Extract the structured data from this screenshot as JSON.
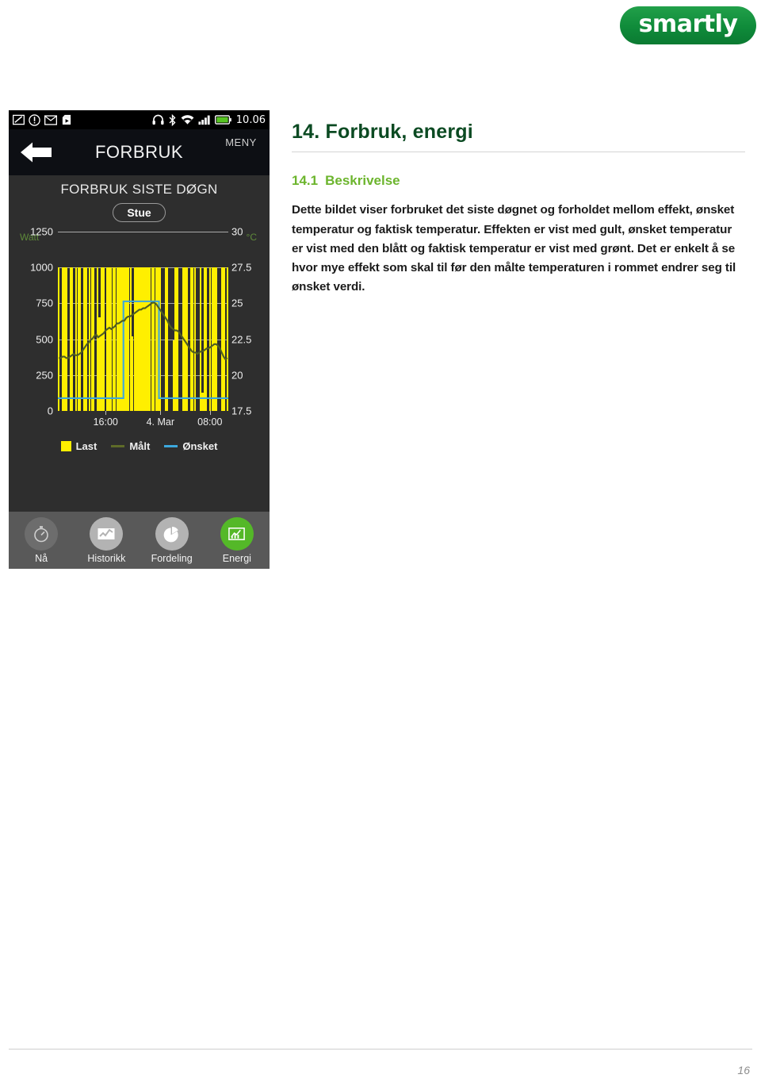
{
  "brand": {
    "name": "smartly",
    "color": "#0f8b3a"
  },
  "document": {
    "heading": "14. Forbruk, energi",
    "subheading_number": "14.1",
    "subheading_title": "Beskrivelse",
    "body": "Dette bildet viser forbruket det siste døgnet og forholdet mellom effekt, ønsket temperatur og faktisk temperatur. Effekten er vist med gult, ønsket temperatur er vist med den blått og faktisk temperatur er vist med grønt. Det er enkelt å se hvor mye effekt som skal til før den målte temperaturen i rommet endrer seg til ønsket verdi.",
    "page_number": "16"
  },
  "phone": {
    "statusbar": {
      "time": "10.06",
      "left_icons": [
        "note-icon",
        "warning-circle-icon",
        "mail-icon",
        "media-play-icon"
      ],
      "right_icons": [
        "headphones-icon",
        "bluetooth-icon",
        "wifi-icon",
        "signal-bars-icon",
        "battery-icon"
      ]
    },
    "titlebar": {
      "back_label": "back-arrow-icon",
      "title": "FORBRUK",
      "menu_label": "MENY"
    },
    "section_title": "FORBRUK SISTE DØGN",
    "room_selector": "Stue",
    "legend": [
      {
        "label": "Last",
        "color": "#ffef00",
        "kind": "box"
      },
      {
        "label": "Målt",
        "color": "#5e6b28",
        "kind": "line"
      },
      {
        "label": "Ønsket",
        "color": "#3ca8dd",
        "kind": "line"
      }
    ],
    "bottom_nav": [
      {
        "label": "Nå",
        "icon": "stopwatch-icon",
        "active": false
      },
      {
        "label": "Historikk",
        "icon": "line-chart-icon",
        "active": false
      },
      {
        "label": "Fordeling",
        "icon": "pie-chart-icon",
        "active": false
      },
      {
        "label": "Energi",
        "icon": "energy-chart-icon",
        "active": true
      }
    ]
  },
  "chart_data": {
    "type": "bar",
    "title": "FORBRUK SISTE DØGN",
    "xlabel": "",
    "ylabel": "Watt",
    "y2label": "°C",
    "ylim": [
      0,
      1250
    ],
    "y2lim": [
      17.5,
      30
    ],
    "yticks": [
      0,
      250,
      500,
      750,
      1000,
      1250
    ],
    "y2ticks": [
      17.5,
      20,
      22.5,
      25,
      27.5,
      30
    ],
    "xticks": [
      "16:00",
      "4. Mar",
      "08:00"
    ],
    "xtick_positions": [
      0.27,
      0.58,
      0.86
    ],
    "grid": true,
    "legend_position": "bottom",
    "series": [
      {
        "name": "Last",
        "type": "bar",
        "unit": "Watt",
        "color": "#ffef00",
        "values": [
          1000,
          0,
          1000,
          1000,
          1000,
          0,
          1000,
          1000,
          0,
          1000,
          1000,
          1000,
          0,
          1000,
          1000,
          0,
          1000,
          1000,
          1000,
          0,
          1000,
          650,
          1000,
          1000,
          0,
          1000,
          1000,
          1000,
          1000,
          1000,
          1000,
          1000,
          1000,
          1000,
          1000,
          1000,
          1000,
          1000,
          520,
          1000,
          1000,
          1000,
          1000,
          1000,
          1000,
          1000,
          1000,
          1000,
          1000,
          1000,
          1000,
          1000,
          1000,
          0,
          0,
          1000,
          1000,
          0,
          0,
          490,
          1000,
          1000,
          0,
          0,
          1000,
          1000,
          1000,
          0,
          1000,
          1000,
          1000,
          0,
          0,
          1000,
          130,
          1000,
          1000,
          0,
          1000,
          1000,
          1000,
          1000,
          0,
          0,
          1000,
          1000,
          0,
          1000,
          1000,
          0,
          1000
        ]
      },
      {
        "name": "Målt",
        "type": "line",
        "unit": "°C",
        "color": "#5e6b28",
        "values": [
          20.9,
          20.9,
          21.0,
          21.0,
          20.9,
          20.9,
          21.0,
          21.1,
          21.2,
          21.1,
          21.1,
          21.2,
          21.3,
          21.5,
          21.7,
          21.9,
          22.0,
          22.2,
          22.3,
          22.5,
          22.6,
          22.4,
          22.5,
          22.6,
          22.7,
          22.9,
          23.0,
          23.1,
          23.0,
          23.1,
          23.2,
          23.4,
          23.4,
          23.5,
          23.6,
          23.6,
          23.8,
          23.9,
          23.9,
          24.0,
          24.1,
          24.2,
          24.3,
          24.4,
          24.4,
          24.5,
          24.5,
          24.6,
          24.7,
          24.8,
          24.9,
          24.9,
          24.8,
          24.6,
          24.4,
          24.2,
          24.0,
          23.8,
          23.6,
          23.3,
          23.1,
          23.0,
          22.9,
          22.9,
          22.8,
          22.6,
          22.4,
          22.2,
          22.0,
          21.8,
          21.6,
          21.4,
          21.3,
          21.3,
          21.2,
          21.3,
          21.4,
          21.4,
          21.5,
          21.6,
          21.6,
          21.7,
          21.8,
          21.9,
          21.9,
          21.8,
          21.6,
          21.3,
          21.0,
          20.8,
          20.9
        ]
      },
      {
        "name": "Ønsket",
        "type": "step-line",
        "unit": "°C",
        "color": "#3ca8dd",
        "values": [
          18.0,
          18.0,
          18.0,
          18.0,
          18.0,
          18.0,
          18.0,
          18.0,
          18.0,
          18.0,
          18.0,
          18.0,
          18.0,
          18.0,
          18.0,
          18.0,
          18.0,
          18.0,
          18.0,
          18.0,
          18.0,
          18.0,
          18.0,
          18.0,
          18.0,
          18.0,
          18.0,
          18.0,
          18.0,
          18.0,
          18.0,
          18.0,
          18.0,
          18.0,
          18.0,
          25.0,
          25.0,
          25.0,
          25.0,
          25.0,
          25.0,
          25.0,
          25.0,
          25.0,
          25.0,
          25.0,
          25.0,
          25.0,
          25.0,
          25.0,
          25.0,
          25.0,
          25.0,
          25.0,
          18.0,
          18.0,
          18.0,
          18.0,
          18.0,
          18.0,
          18.0,
          18.0,
          18.0,
          18.0,
          18.0,
          18.0,
          18.0,
          18.0,
          18.0,
          18.0,
          18.0,
          18.0,
          18.0,
          18.0,
          18.0,
          18.0,
          18.0,
          18.0,
          18.0,
          18.0,
          18.0,
          18.0,
          18.0,
          18.0,
          18.0,
          18.0,
          18.0,
          18.0,
          18.0,
          18.0,
          18.0
        ]
      }
    ]
  }
}
